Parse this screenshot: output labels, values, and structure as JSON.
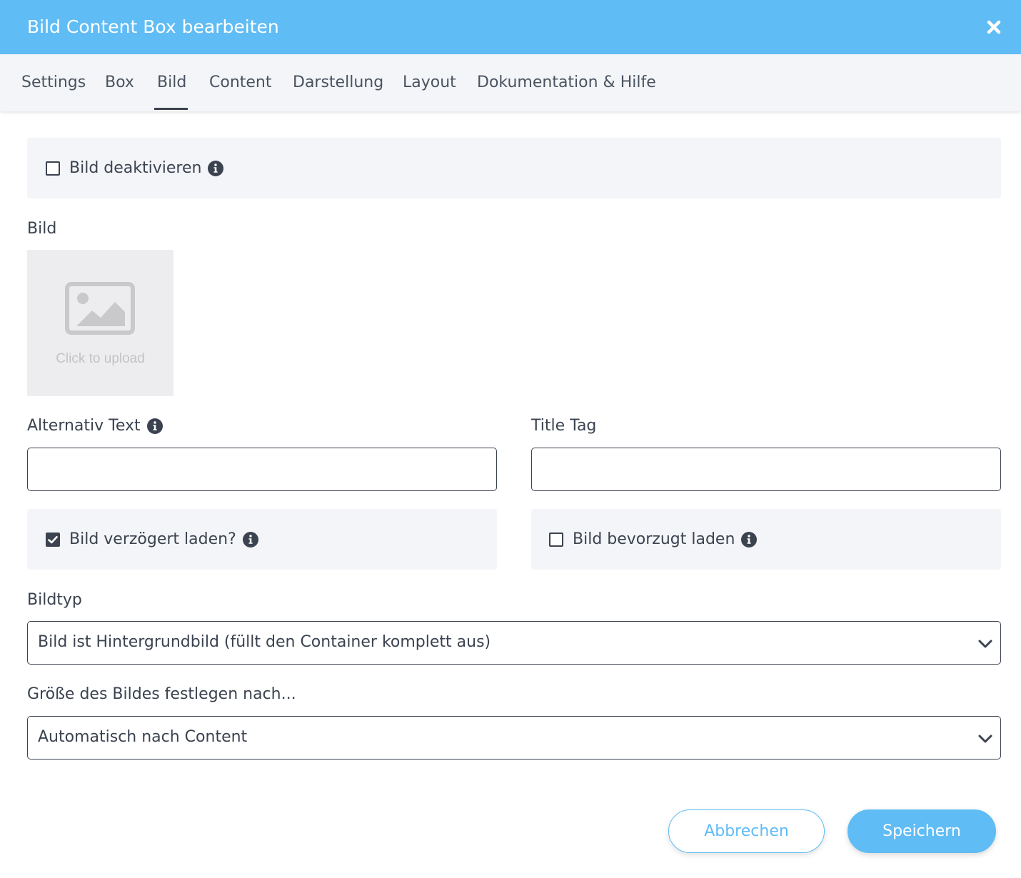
{
  "dialog": {
    "title": "Bild Content Box bearbeiten"
  },
  "tabs": [
    {
      "label": "Settings"
    },
    {
      "label": "Box"
    },
    {
      "label": "Bild",
      "active": true
    },
    {
      "label": "Content"
    },
    {
      "label": "Darstellung"
    },
    {
      "label": "Layout"
    },
    {
      "label": "Dokumentation & Hilfe"
    }
  ],
  "form": {
    "disable_image": {
      "label": "Bild deaktivieren",
      "checked": false
    },
    "image": {
      "label": "Bild",
      "upload_text": "Click to upload"
    },
    "alt_text": {
      "label": "Alternativ Text",
      "value": ""
    },
    "title_tag": {
      "label": "Title Tag",
      "value": ""
    },
    "lazy_load": {
      "label": "Bild verzögert laden?",
      "checked": true
    },
    "priority_load": {
      "label": "Bild bevorzugt laden",
      "checked": false
    },
    "image_type": {
      "label": "Bildtyp",
      "value": "Bild ist Hintergrundbild (füllt den Container komplett aus)"
    },
    "image_size": {
      "label": "Größe des Bildes festlegen nach...",
      "value": "Automatisch nach Content"
    }
  },
  "buttons": {
    "cancel": "Abbrechen",
    "save": "Speichern"
  },
  "colors": {
    "accent": "#5fbcf5",
    "text": "#3b4350",
    "panel": "#f4f5f8"
  }
}
